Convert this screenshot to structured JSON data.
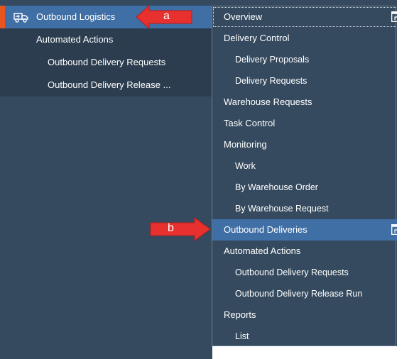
{
  "left_nav": {
    "items": [
      {
        "label": "Outbound Logistics",
        "icon": "truck-icon",
        "selected": true
      },
      {
        "label": "Automated Actions"
      },
      {
        "label": "Outbound Delivery Requests"
      },
      {
        "label": "Outbound Delivery Release ..."
      }
    ]
  },
  "callouts": {
    "a": "a",
    "b": "b"
  },
  "flyout": {
    "items": [
      {
        "label": "Overview",
        "level": 1
      },
      {
        "label": "Delivery Control",
        "level": 1
      },
      {
        "label": "Delivery Proposals",
        "level": 2
      },
      {
        "label": "Delivery Requests",
        "level": 2
      },
      {
        "label": "Warehouse Requests",
        "level": 1
      },
      {
        "label": "Task Control",
        "level": 1
      },
      {
        "label": "Monitoring",
        "level": 1
      },
      {
        "label": "Work",
        "level": 2
      },
      {
        "label": "By Warehouse Order",
        "level": 2
      },
      {
        "label": "By Warehouse Request",
        "level": 2
      },
      {
        "label": "Outbound Deliveries",
        "level": 1,
        "active": true
      },
      {
        "label": "Automated Actions",
        "level": 1
      },
      {
        "label": "Outbound Delivery Requests",
        "level": 2
      },
      {
        "label": "Outbound Delivery Release Run",
        "level": 2
      },
      {
        "label": "Reports",
        "level": 1
      },
      {
        "label": "List",
        "level": 2
      }
    ]
  },
  "colors": {
    "background": "#354a5f",
    "nav_row": "#2b3d4f",
    "selected": "#3f6fa5",
    "accent": "#e8541e",
    "callout": "#e8312e"
  }
}
